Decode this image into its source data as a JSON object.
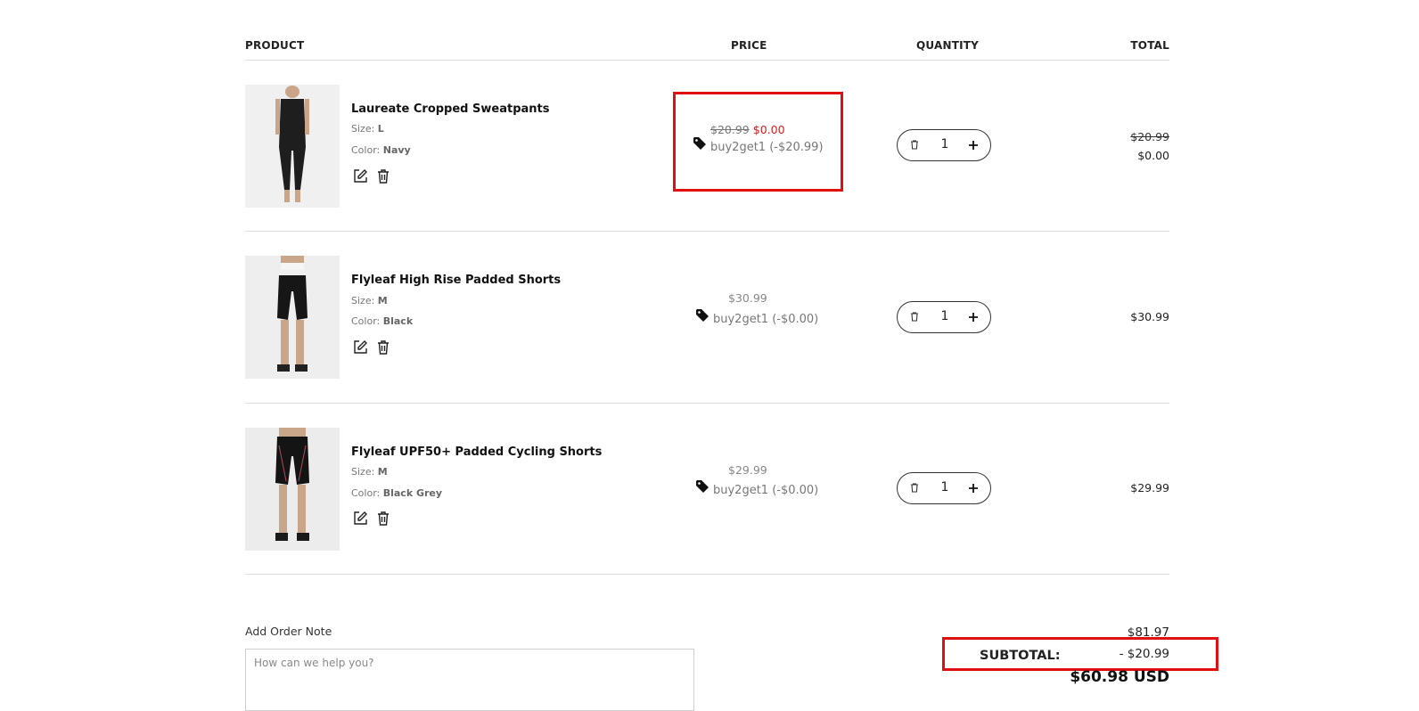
{
  "table": {
    "headers": {
      "product": "PRODUCT",
      "price": "PRICE",
      "quantity": "QUANTITY",
      "total": "TOTAL"
    }
  },
  "items": [
    {
      "name": "Laureate Cropped Sweatpants",
      "size_label": "Size:",
      "size": "L",
      "color_label": "Color:",
      "color": "Navy",
      "price_original": "$20.99",
      "price_sale": "$0.00",
      "discount": "buy2get1 (-$20.99)",
      "quantity": "1",
      "total_original": "$20.99",
      "total": "$0.00"
    },
    {
      "name": "Flyleaf High Rise Padded Shorts",
      "size_label": "Size:",
      "size": "M",
      "color_label": "Color:",
      "color": "Black",
      "price": "$30.99",
      "discount": "buy2get1 (-$0.00)",
      "quantity": "1",
      "total": "$30.99"
    },
    {
      "name": "Flyleaf UPF50+ Padded Cycling Shorts",
      "size_label": "Size:",
      "size": "M",
      "color_label": "Color:",
      "color": "Black Grey",
      "price": "$29.99",
      "discount": "buy2get1 (-$0.00)",
      "quantity": "1",
      "total": "$29.99"
    }
  ],
  "order_note": {
    "label": "Add Order Note",
    "placeholder": "How can we help you?"
  },
  "summary": {
    "amount": "$81.97",
    "subtotal_label": "SUBTOTAL:",
    "discount": "- $20.99",
    "total": "$60.98 USD"
  },
  "icons": {
    "edit": "edit-icon",
    "delete": "trash-icon",
    "tag": "tag-icon",
    "minus": "trash-icon",
    "plus": "plus-icon"
  },
  "colors": {
    "sale_red": "#d02020",
    "highlight_red": "#e01010"
  }
}
